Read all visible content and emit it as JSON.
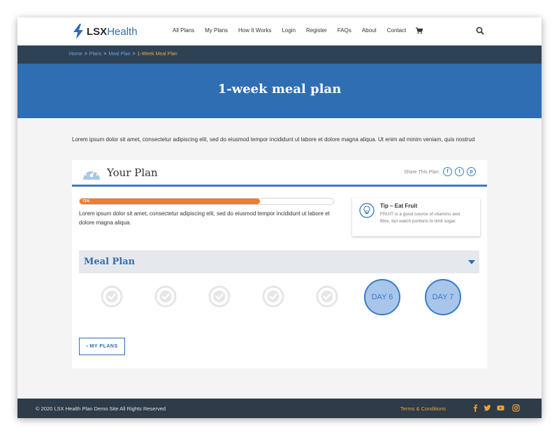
{
  "header": {
    "logo_bold": "LSX",
    "logo_rest": "Health",
    "nav": [
      "All Plans",
      "My Plans",
      "How It Works",
      "Login",
      "Register",
      "FAQs",
      "About",
      "Contact"
    ]
  },
  "breadcrumb": {
    "items": [
      "Home",
      "Plans",
      "Meal Plan"
    ],
    "current": "1-Week Meal Plan"
  },
  "hero": {
    "title": "1-week meal plan"
  },
  "intro": "Lorem ipsum dolor sit amet, consectetur adipiscing elit, sed do eiusmod tempor incididunt ut labore et dolore magna aliqua. Ut enim ad minim veniam, quis nostrud",
  "plan": {
    "title": "Your Plan",
    "share_label": "Share This Plan:",
    "progress_percent": 71,
    "progress_label": "71%",
    "progress_text": "Lorem ipsum dolor sit amet, consectetur adipiscing elit, sed do eiusmod tempor incididunt ut labore et dolore magna aliqua."
  },
  "tip": {
    "title": "Tip – Eat Fruit",
    "text": "FRUIT is a good source of vitamins and fibre, but watch portions to limit sugar."
  },
  "meal_plan": {
    "title": "Meal Plan",
    "days": [
      {
        "label": "",
        "completed": true
      },
      {
        "label": "",
        "completed": true
      },
      {
        "label": "",
        "completed": true
      },
      {
        "label": "",
        "completed": true
      },
      {
        "label": "",
        "completed": true
      },
      {
        "label": "DAY 6",
        "completed": false
      },
      {
        "label": "DAY 7",
        "completed": false
      }
    ]
  },
  "back_button": "‹ MY PLANS",
  "footer": {
    "copyright": "© 2020 LSX Health Plan Demo Site All Rights Reserved",
    "terms": "Terms & Conditions"
  },
  "colors": {
    "brand_blue": "#2f6eb2",
    "dark_navy": "#2e4256",
    "accent_orange": "#f07c2e",
    "link_orange": "#f3a23a"
  },
  "icons": {
    "logo": "lightning-bolt-icon",
    "cart": "cart-icon",
    "search": "search-icon",
    "plan": "gauge-icon",
    "tip": "lightbulb-icon",
    "day_done": "check-circle-icon",
    "social": [
      "facebook-icon",
      "twitter-icon",
      "youtube-icon",
      "instagram-icon"
    ],
    "share": [
      "facebook-icon",
      "twitter-icon",
      "pinterest-icon"
    ]
  }
}
